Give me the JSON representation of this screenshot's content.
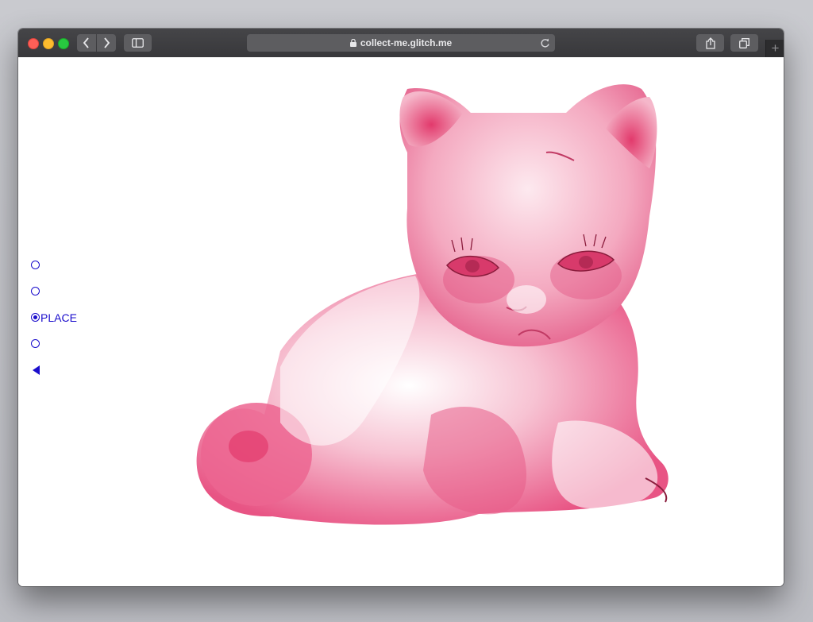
{
  "browser": {
    "url": "collect-me.glitch.me",
    "new_tab_symbol": "+"
  },
  "nav": {
    "items": [
      {
        "label": "",
        "selected": false
      },
      {
        "label": "",
        "selected": false
      },
      {
        "label": "PLACE",
        "selected": true
      },
      {
        "label": "",
        "selected": false
      }
    ],
    "back_icon": "left-triangle-icon"
  },
  "colors": {
    "link": "#1a0dcc",
    "kitten_pink": "#ea5a86",
    "titlebar": "#3d3d40"
  }
}
